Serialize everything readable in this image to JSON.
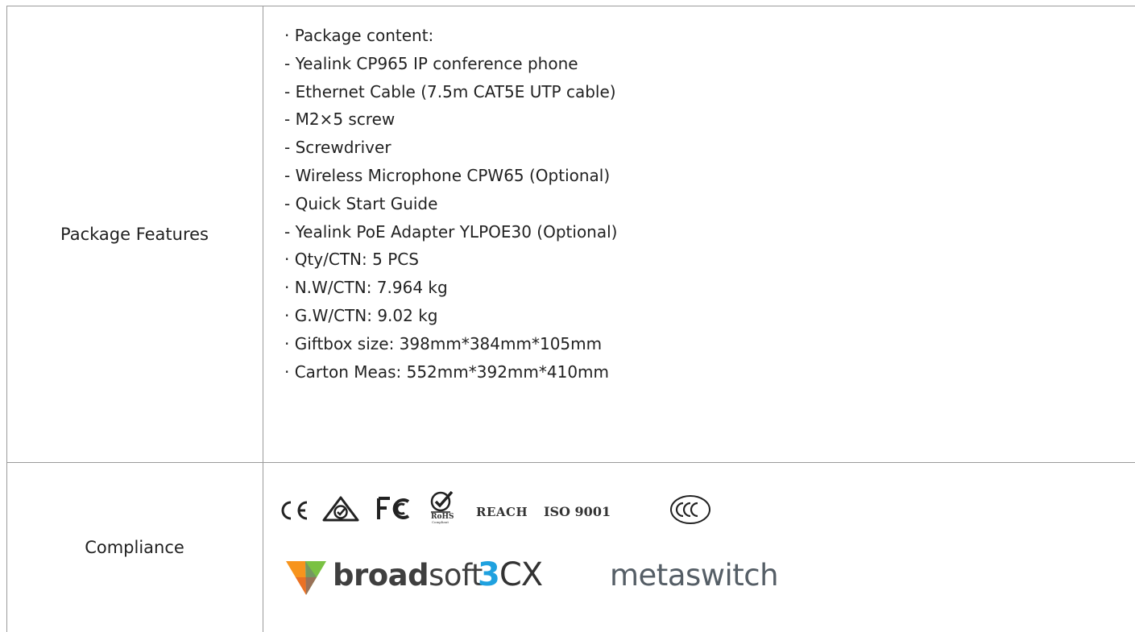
{
  "rows": [
    {
      "label": "Package Features",
      "items": [
        "· Package content:",
        "- Yealink CP965 IP conference phone",
        "- Ethernet Cable (7.5m CAT5E UTP cable)",
        "- M2×5 screw",
        "- Screwdriver",
        "- Wireless Microphone CPW65 (Optional)",
        "- Quick Start Guide",
        "- Yealink PoE Adapter YLPOE30 (Optional)",
        "· Qty/CTN: 5 PCS",
        "· N.W/CTN: 7.964 kg",
        "· G.W/CTN: 9.02 kg",
        "· Giftbox size: 398mm*384mm*105mm",
        "· Carton Meas: 552mm*392mm*410mm"
      ]
    },
    {
      "label": "Compliance",
      "certifications": [
        "CE",
        "RCM",
        "FC",
        "RoHS",
        "REACH",
        "ISO 9001",
        "CCC"
      ],
      "rohs_text": "RoHS",
      "rohs_subtext": "Compliant",
      "reach_text": "REACH",
      "iso_text": "ISO 9001",
      "partners": [
        "broadsoft",
        "3CX",
        "metaswitch"
      ],
      "broadsoft": {
        "bold": "broad",
        "regular": "soft"
      },
      "cx": {
        "digit": "3",
        "rest": "CX"
      },
      "metaswitch_text": "metaswitch"
    }
  ],
  "colors": {
    "border": "#9a9a9a",
    "text": "#222222",
    "threecx_blue": "#1fa1df",
    "broadsoft_orange": "#f7941d",
    "broadsoft_green": "#7ac143",
    "broadsoft_purple": "#6b4c9a"
  }
}
